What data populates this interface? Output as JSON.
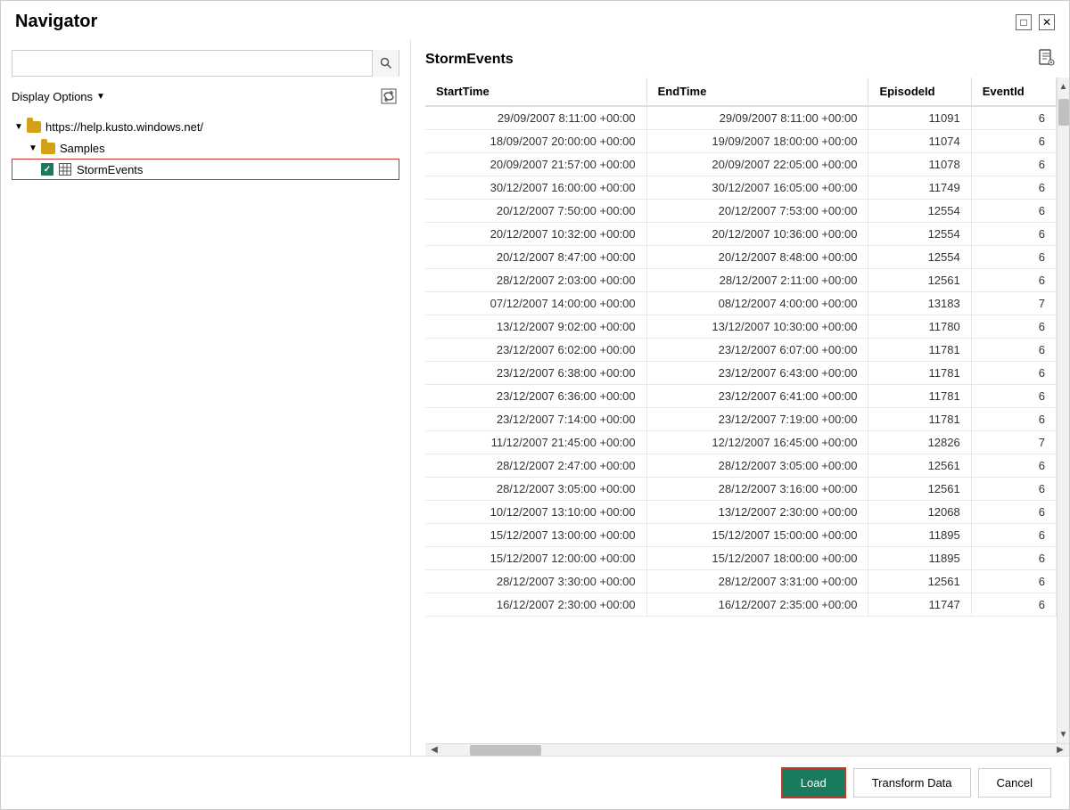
{
  "window": {
    "title": "Navigator"
  },
  "left_panel": {
    "search_placeholder": "",
    "display_options_label": "Display Options",
    "tree": {
      "server_url": "https://help.kusto.windows.net/",
      "db_name": "Samples",
      "table_name": "StormEvents"
    }
  },
  "right_panel": {
    "title": "StormEvents",
    "columns": [
      "StartTime",
      "EndTime",
      "EpisodeId",
      "EventId"
    ],
    "rows": [
      {
        "start": "29/09/2007 8:11:00 +00:00",
        "end": "29/09/2007 8:11:00 +00:00",
        "episode": "11091",
        "event": "6"
      },
      {
        "start": "18/09/2007 20:00:00 +00:00",
        "end": "19/09/2007 18:00:00 +00:00",
        "episode": "11074",
        "event": "6"
      },
      {
        "start": "20/09/2007 21:57:00 +00:00",
        "end": "20/09/2007 22:05:00 +00:00",
        "episode": "11078",
        "event": "6"
      },
      {
        "start": "30/12/2007 16:00:00 +00:00",
        "end": "30/12/2007 16:05:00 +00:00",
        "episode": "11749",
        "event": "6"
      },
      {
        "start": "20/12/2007 7:50:00 +00:00",
        "end": "20/12/2007 7:53:00 +00:00",
        "episode": "12554",
        "event": "6"
      },
      {
        "start": "20/12/2007 10:32:00 +00:00",
        "end": "20/12/2007 10:36:00 +00:00",
        "episode": "12554",
        "event": "6"
      },
      {
        "start": "20/12/2007 8:47:00 +00:00",
        "end": "20/12/2007 8:48:00 +00:00",
        "episode": "12554",
        "event": "6"
      },
      {
        "start": "28/12/2007 2:03:00 +00:00",
        "end": "28/12/2007 2:11:00 +00:00",
        "episode": "12561",
        "event": "6"
      },
      {
        "start": "07/12/2007 14:00:00 +00:00",
        "end": "08/12/2007 4:00:00 +00:00",
        "episode": "13183",
        "event": "7"
      },
      {
        "start": "13/12/2007 9:02:00 +00:00",
        "end": "13/12/2007 10:30:00 +00:00",
        "episode": "11780",
        "event": "6"
      },
      {
        "start": "23/12/2007 6:02:00 +00:00",
        "end": "23/12/2007 6:07:00 +00:00",
        "episode": "11781",
        "event": "6"
      },
      {
        "start": "23/12/2007 6:38:00 +00:00",
        "end": "23/12/2007 6:43:00 +00:00",
        "episode": "11781",
        "event": "6"
      },
      {
        "start": "23/12/2007 6:36:00 +00:00",
        "end": "23/12/2007 6:41:00 +00:00",
        "episode": "11781",
        "event": "6"
      },
      {
        "start": "23/12/2007 7:14:00 +00:00",
        "end": "23/12/2007 7:19:00 +00:00",
        "episode": "11781",
        "event": "6"
      },
      {
        "start": "11/12/2007 21:45:00 +00:00",
        "end": "12/12/2007 16:45:00 +00:00",
        "episode": "12826",
        "event": "7"
      },
      {
        "start": "28/12/2007 2:47:00 +00:00",
        "end": "28/12/2007 3:05:00 +00:00",
        "episode": "12561",
        "event": "6"
      },
      {
        "start": "28/12/2007 3:05:00 +00:00",
        "end": "28/12/2007 3:16:00 +00:00",
        "episode": "12561",
        "event": "6"
      },
      {
        "start": "10/12/2007 13:10:00 +00:00",
        "end": "13/12/2007 2:30:00 +00:00",
        "episode": "12068",
        "event": "6"
      },
      {
        "start": "15/12/2007 13:00:00 +00:00",
        "end": "15/12/2007 15:00:00 +00:00",
        "episode": "11895",
        "event": "6"
      },
      {
        "start": "15/12/2007 12:00:00 +00:00",
        "end": "15/12/2007 18:00:00 +00:00",
        "episode": "11895",
        "event": "6"
      },
      {
        "start": "28/12/2007 3:30:00 +00:00",
        "end": "28/12/2007 3:31:00 +00:00",
        "episode": "12561",
        "event": "6"
      },
      {
        "start": "16/12/2007 2:30:00 +00:00",
        "end": "16/12/2007 2:35:00 +00:00",
        "episode": "11747",
        "event": "6"
      }
    ]
  },
  "footer": {
    "load_label": "Load",
    "transform_label": "Transform Data",
    "cancel_label": "Cancel"
  }
}
